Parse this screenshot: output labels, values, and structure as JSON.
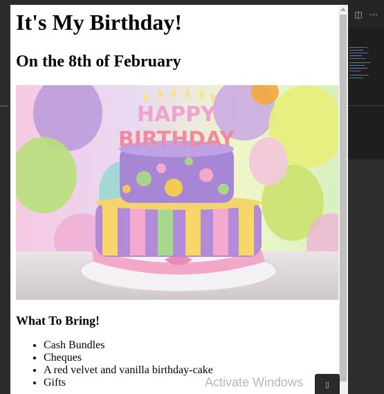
{
  "page": {
    "title": "It's My Birthday!",
    "subtitle": "On the 8th of February",
    "image_alt": "birthday cake photo",
    "bring_heading": "What To Bring!",
    "bring_items": [
      "Cash Bundles",
      "Cheques",
      "A red velvet and vanilla birthday-cake",
      "Gifts"
    ]
  },
  "watermark": {
    "text": "Activate Windows"
  },
  "cake": {
    "top_text": "HAPPY",
    "bottom_text": "BIRTHDAY"
  },
  "colors": {
    "editor_bg": "#1e1e1e",
    "page_bg": "#ffffff",
    "scroll_thumb": "#c1c1c1"
  }
}
